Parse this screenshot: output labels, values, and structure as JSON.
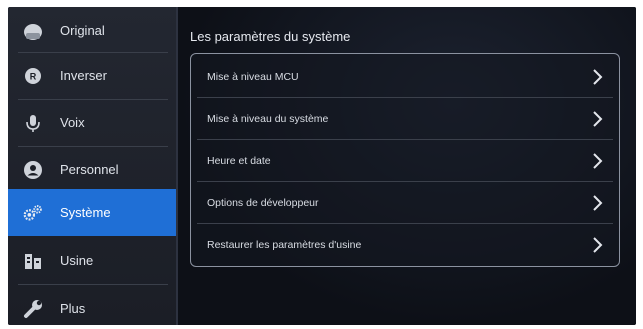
{
  "sidebar": {
    "items": [
      {
        "label": "Original",
        "icon": "original-icon"
      },
      {
        "label": "Inverser",
        "icon": "inverser-icon"
      },
      {
        "label": "Voix",
        "icon": "microphone-icon"
      },
      {
        "label": "Personnel",
        "icon": "person-icon"
      },
      {
        "label": "Système",
        "icon": "gears-icon"
      },
      {
        "label": "Usine",
        "icon": "factory-icon"
      },
      {
        "label": "Plus",
        "icon": "wrench-icon"
      }
    ],
    "active_index": 4
  },
  "main": {
    "title": "Les paramètres du système",
    "options": [
      {
        "label": "Mise à niveau MCU"
      },
      {
        "label": "Mise à niveau du système"
      },
      {
        "label": "Heure et date"
      },
      {
        "label": "Options de développeur"
      },
      {
        "label": "Restaurer les paramètres d'usine"
      }
    ]
  },
  "colors": {
    "active": "#1f6fd6",
    "background": "#0b0e14",
    "sidebar": "#232731",
    "panel_border": "#8b92a0"
  }
}
